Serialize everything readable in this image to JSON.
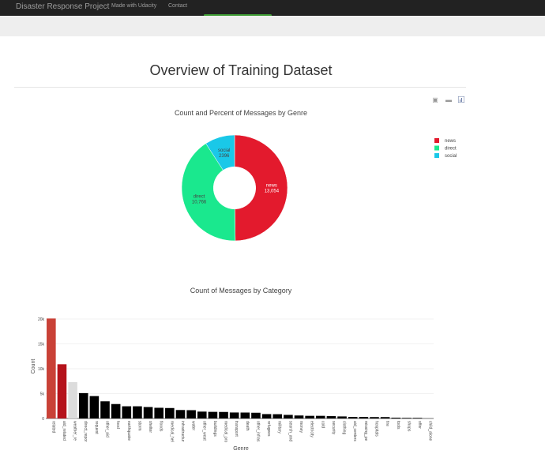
{
  "navbar": {
    "brand": "Disaster Response Project",
    "links": [
      "Made with Udacity",
      "Contact"
    ]
  },
  "page_title": "Overview of Training Dataset",
  "modebar_icons": [
    "camera-icon",
    "pan-icon",
    "bar-chart-icon"
  ],
  "chart_data": [
    {
      "type": "pie",
      "title": "Count and Percent of Messages by Genre",
      "labels": [
        "news",
        "direct",
        "social"
      ],
      "values": [
        13054,
        10766,
        2396
      ],
      "value_labels": [
        "13,054",
        "10,766",
        "2396"
      ],
      "colors": [
        "#e31a2d",
        "#1ae88e",
        "#1ac8e8"
      ],
      "hole": 0.4,
      "legend_position": "top-right"
    },
    {
      "type": "bar",
      "title": "Count of Messages by Category",
      "xlabel": "Genre",
      "ylabel": "Count",
      "ylim": [
        0,
        20000
      ],
      "yticks": [
        0,
        5000,
        10000,
        15000,
        20000
      ],
      "ytick_labels": [
        "0",
        "5k",
        "10k",
        "15k",
        "20k"
      ],
      "grid": true,
      "categories": [
        "related",
        "aid_related",
        "weather_re",
        "direct_repor",
        "request",
        "other_aid",
        "food",
        "earthquake",
        "storm",
        "shelter",
        "floods",
        "medical_hel",
        "infrastructur",
        "water",
        "other_weat",
        "buildings",
        "medical_pro",
        "transport",
        "death",
        "other_infras",
        "refugees",
        "military",
        "search_and",
        "money",
        "electricity",
        "cold",
        "security",
        "clothing",
        "aid_centers",
        "missing_pe",
        "hospitals",
        "fire",
        "tools",
        "shops",
        "offer",
        "child_alone"
      ],
      "values": [
        20100,
        10900,
        7300,
        5100,
        4500,
        3450,
        2900,
        2450,
        2450,
        2300,
        2150,
        2100,
        1700,
        1670,
        1380,
        1330,
        1310,
        1200,
        1190,
        1150,
        880,
        860,
        720,
        600,
        530,
        530,
        470,
        410,
        310,
        300,
        280,
        280,
        160,
        120,
        120,
        0
      ],
      "bar_colors": [
        "#c94137",
        "#b5121b",
        "#dcdcdc",
        "#000000",
        "#000000",
        "#000000",
        "#000000",
        "#000000",
        "#000000",
        "#000000",
        "#000000",
        "#000000",
        "#000000",
        "#000000",
        "#000000",
        "#000000",
        "#000000",
        "#000000",
        "#000000",
        "#000000",
        "#000000",
        "#000000",
        "#000000",
        "#000000",
        "#000000",
        "#000000",
        "#000000",
        "#000000",
        "#000000",
        "#000000",
        "#000000",
        "#000000",
        "#000000",
        "#000000",
        "#000000",
        "#000000"
      ]
    }
  ]
}
